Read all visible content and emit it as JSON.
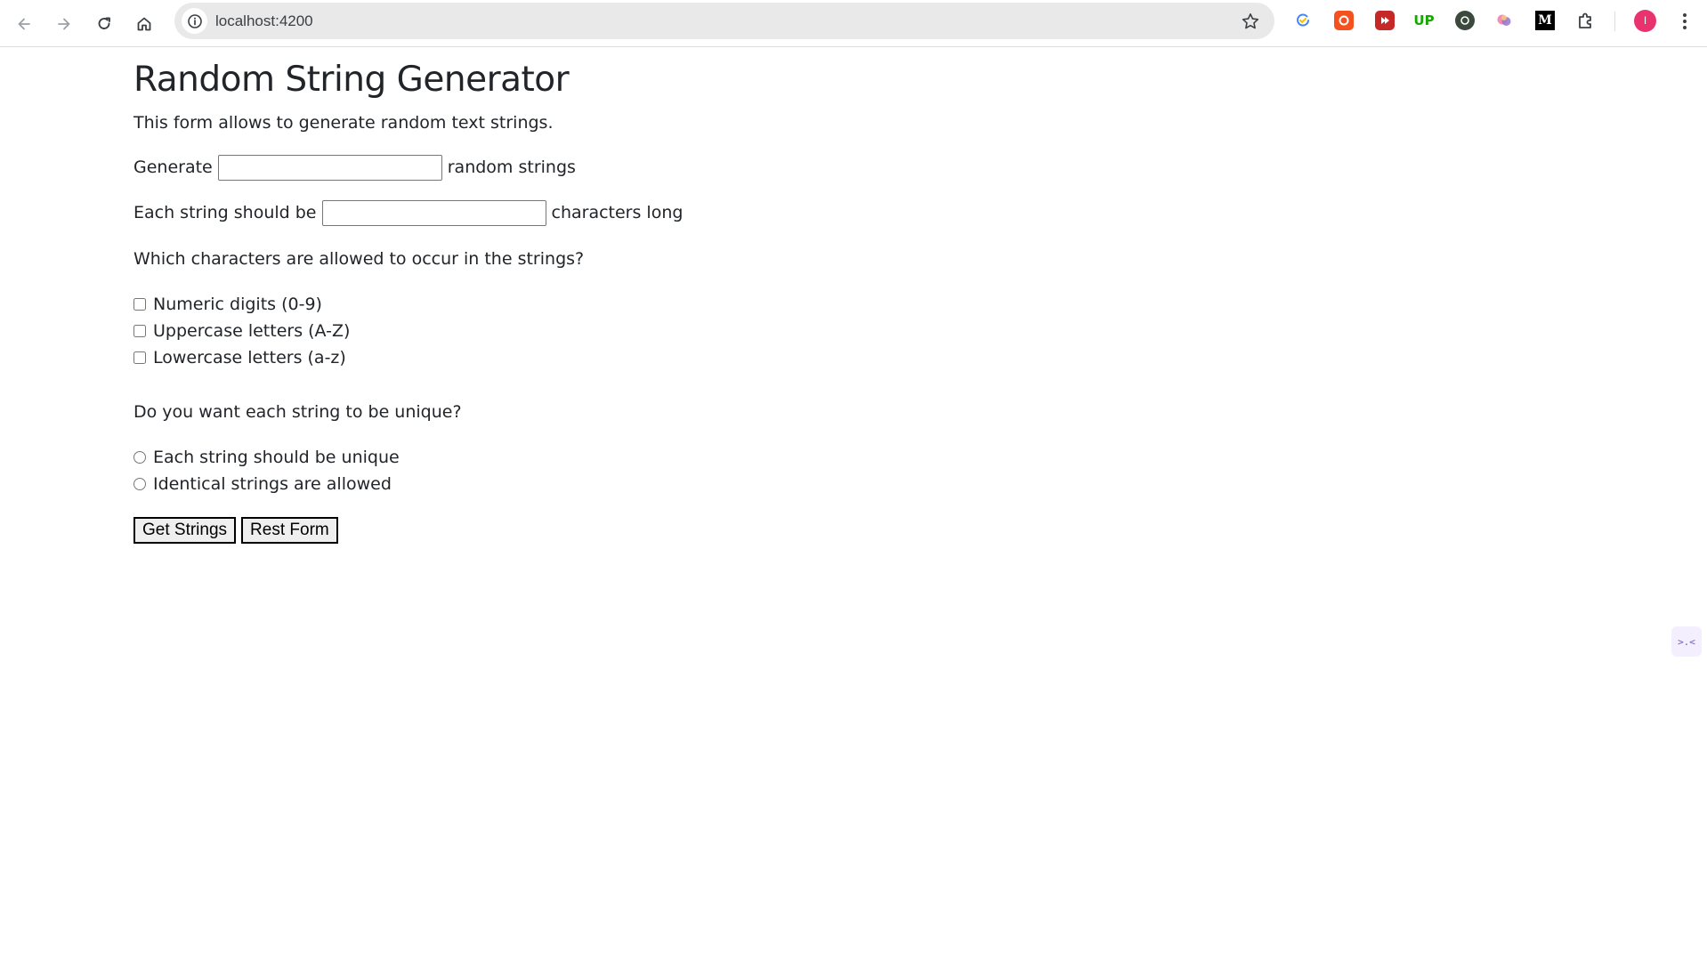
{
  "browser": {
    "url": "localhost:4200",
    "avatar_letter": "I",
    "extensions": [
      "extension-1",
      "extension-2",
      "extension-3",
      "extension-4",
      "extension-5",
      "extension-6",
      "extension-7",
      "extensions-puzzle"
    ],
    "ext4_label": "UP",
    "ext7_label": "M"
  },
  "page": {
    "title": "Random String Generator",
    "intro": "This form allows to generate random text strings.",
    "count_row": {
      "prefix": "Generate",
      "value": "",
      "suffix": "random strings"
    },
    "length_row": {
      "prefix": "Each string should be",
      "value": "",
      "suffix": "characters long"
    },
    "chars_question": "Which characters are allowed to occur in the strings?",
    "char_options": [
      {
        "label": "Numeric digits (0-9)",
        "checked": false
      },
      {
        "label": "Uppercase letters (A-Z)",
        "checked": false
      },
      {
        "label": "Lowercase letters (a-z)",
        "checked": false
      }
    ],
    "unique_question": "Do you want each string to be unique?",
    "unique_options": [
      {
        "label": "Each string should be unique",
        "checked": false
      },
      {
        "label": "Identical strings are allowed",
        "checked": false
      }
    ],
    "buttons": {
      "submit": "Get Strings",
      "reset": "Rest Form"
    }
  },
  "side_widget": {
    "label": ">.<"
  }
}
